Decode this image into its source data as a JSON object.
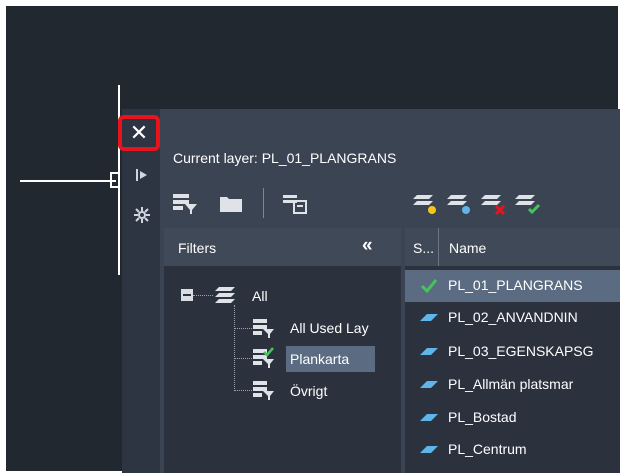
{
  "palette": {
    "title": "Current layer: PL_01_PLANGRANS"
  },
  "side_strip": {
    "icons": [
      "close-icon",
      "pin-icon",
      "settings-icon"
    ]
  },
  "toolbar_left": [
    "new-property-filter-icon",
    "new-group-filter-icon",
    "layer-states-manager-icon"
  ],
  "toolbar_right": [
    "new-layer-icon",
    "new-layer-vp-frozen-icon",
    "delete-layer-icon",
    "set-current-icon"
  ],
  "filters": {
    "title": "Filters",
    "collapse_glyph": "«",
    "tree": [
      {
        "label": "All"
      },
      {
        "label": "All Used Lay"
      },
      {
        "label": "Plankarta",
        "selected": true
      },
      {
        "label": "Övrigt"
      }
    ]
  },
  "layers": {
    "columns": [
      "S...",
      "Name"
    ],
    "rows": [
      {
        "name": "PL_01_PLANGRANS",
        "status": "current"
      },
      {
        "name": "PL_02_ANVANDNIN",
        "status": "normal"
      },
      {
        "name": "PL_03_EGENSKAPSG",
        "status": "normal"
      },
      {
        "name": "PL_Allmän platsmar",
        "status": "normal"
      },
      {
        "name": "PL_Bostad",
        "status": "normal"
      },
      {
        "name": "PL_Centrum",
        "status": "normal"
      }
    ]
  },
  "colors": {
    "highlight_border": "#e8141c",
    "current_check": "#45c45a",
    "layer_parallelogram": "#5fb5ea",
    "selection": "#5a6b82"
  }
}
